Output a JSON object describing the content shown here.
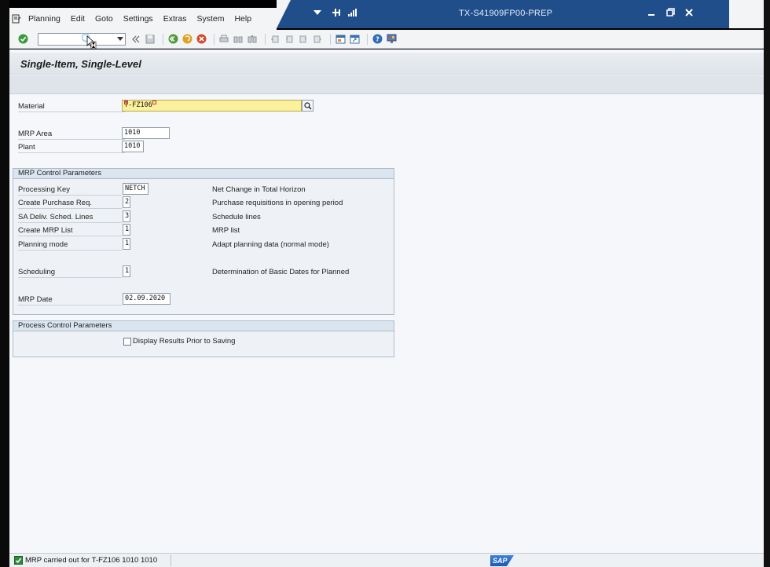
{
  "menu": {
    "items": [
      {
        "label": "Planning"
      },
      {
        "label": "Edit"
      },
      {
        "label": "Goto"
      },
      {
        "label": "Settings"
      },
      {
        "label": "Extras"
      },
      {
        "label": "System"
      },
      {
        "label": "Help"
      }
    ]
  },
  "window": {
    "title": "TX-S41909FP00-PREP"
  },
  "page": {
    "title": "Single-Item, Single-Level"
  },
  "selection": {
    "material": {
      "label": "Material",
      "value": "T-FZ106"
    },
    "mrp_area": {
      "label": "MRP Area",
      "value": "1010"
    },
    "plant": {
      "label": "Plant",
      "value": "1010"
    }
  },
  "mrp_control": {
    "title": "MRP Control Parameters",
    "rows": [
      {
        "label": "Processing Key",
        "value": "NETCH",
        "desc": "Net Change in Total Horizon"
      },
      {
        "label": "Create Purchase Req.",
        "value": "2",
        "desc": "Purchase requisitions in opening period"
      },
      {
        "label": "SA Deliv. Sched. Lines",
        "value": "3",
        "desc": "Schedule lines"
      },
      {
        "label": "Create MRP List",
        "value": "1",
        "desc": "MRP list"
      },
      {
        "label": "Planning mode",
        "value": "1",
        "desc": "Adapt planning data (normal mode)"
      },
      {
        "label": "Scheduling",
        "value": "1",
        "desc": "Determination of Basic Dates for Planned"
      },
      {
        "label": "MRP Date",
        "value": "02.09.2020",
        "desc": ""
      }
    ]
  },
  "process_control": {
    "title": "Process Control Parameters",
    "display_results_label": "Display Results Prior to Saving"
  },
  "status": {
    "message": "MRP carried out for T-FZ106  1010  1010",
    "logo": "SAP"
  }
}
